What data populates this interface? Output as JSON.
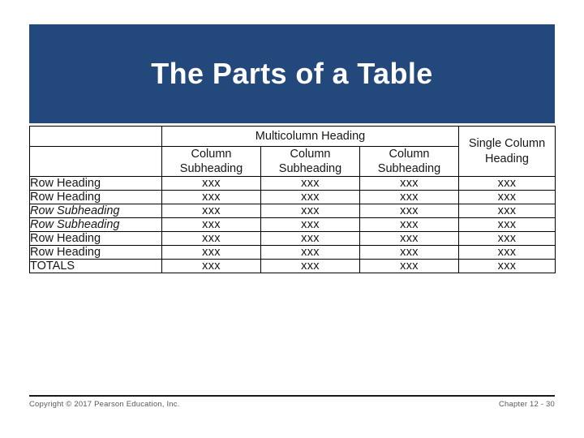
{
  "slide": {
    "title": "The Parts of a Table",
    "banner_color": "#23497c"
  },
  "colors": {
    "banner_blue": "#23497c",
    "multicolumn_orange": "#ff9900",
    "single_column_yellow": "#ffff00",
    "alt_row_peach": "#fbe5d6",
    "grid_black": "#000000",
    "footer_gray": "#585858"
  },
  "table": {
    "header": {
      "corner_label": "",
      "multicolumn_heading": "Multicolumn Heading",
      "single_column_heading": "Single Column Heading",
      "column_subheadings": [
        "Column Subheading",
        "Column Subheading",
        "Column Subheading"
      ]
    },
    "rows": [
      {
        "label": "Row Heading",
        "type": "heading",
        "shaded": false,
        "values": [
          "xxx",
          "xxx",
          "xxx",
          "xxx"
        ]
      },
      {
        "label": "Row Heading",
        "type": "heading",
        "shaded": true,
        "values": [
          "xxx",
          "xxx",
          "xxx",
          "xxx"
        ]
      },
      {
        "label": "Row Subheading",
        "type": "subheading",
        "shaded": false,
        "values": [
          "xxx",
          "xxx",
          "xxx",
          "xxx"
        ]
      },
      {
        "label": "Row Subheading",
        "type": "subheading",
        "shaded": true,
        "values": [
          "xxx",
          "xxx",
          "xxx",
          "xxx"
        ]
      },
      {
        "label": "Row Heading",
        "type": "heading",
        "shaded": false,
        "values": [
          "xxx",
          "xxx",
          "xxx",
          "xxx"
        ]
      },
      {
        "label": "Row Heading",
        "type": "heading",
        "shaded": true,
        "values": [
          "xxx",
          "xxx",
          "xxx",
          "xxx"
        ]
      },
      {
        "label": "TOTALS",
        "type": "totals",
        "shaded": false,
        "values": [
          "xxx",
          "xxx",
          "xxx",
          "xxx"
        ]
      }
    ]
  },
  "footer": {
    "copyright": "Copyright © 2017 Pearson Education, Inc.",
    "chapter": "Chapter 12 - 30"
  }
}
